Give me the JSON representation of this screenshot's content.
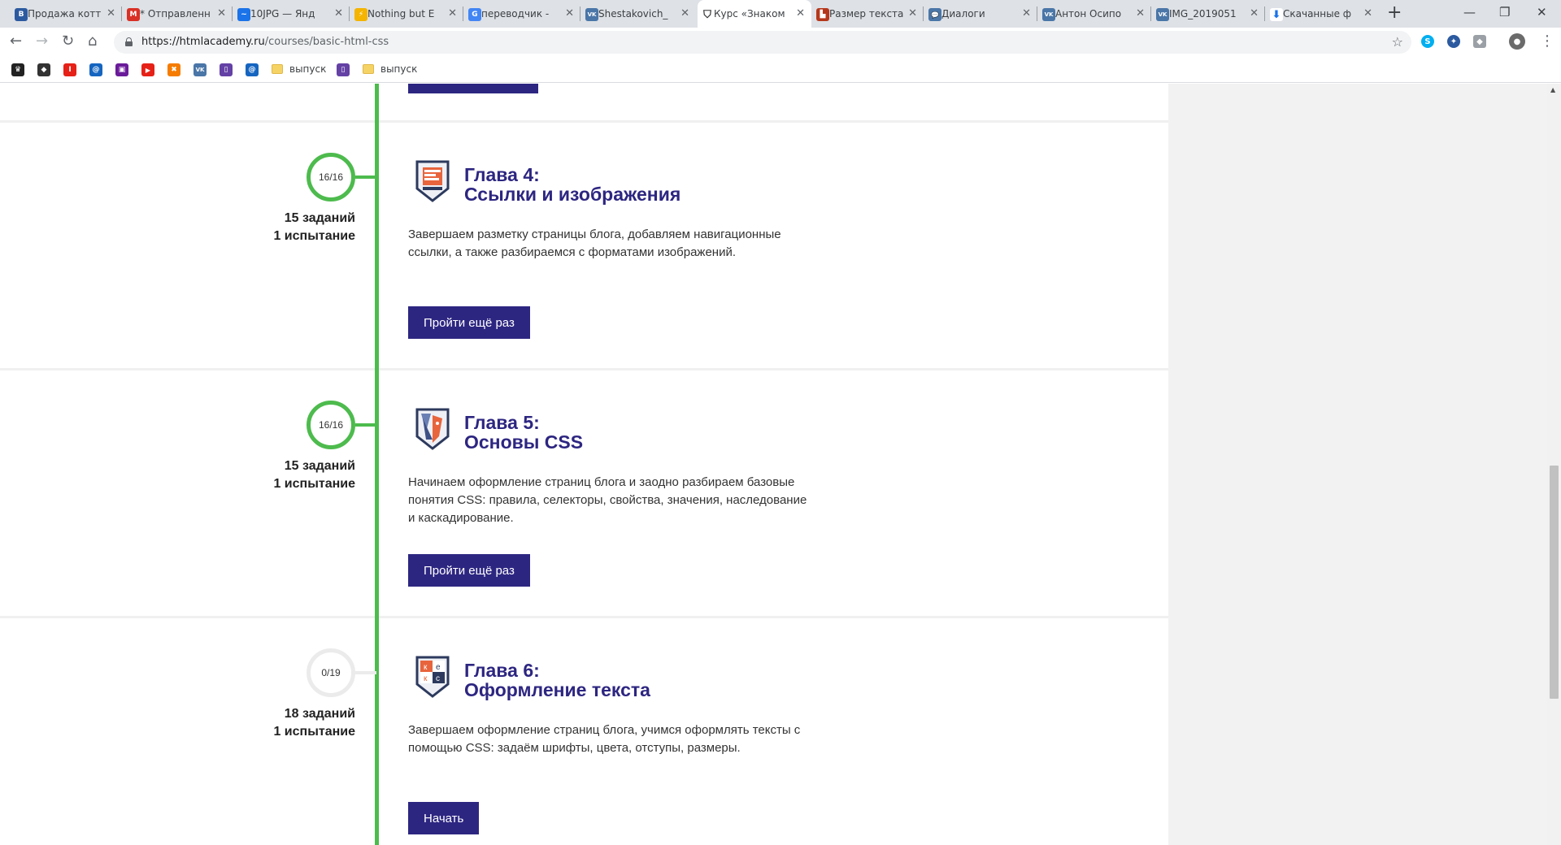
{
  "browser": {
    "tabs": [
      {
        "title": "Продажа котт",
        "favicon_color": "#2c5aa0",
        "favicon_char": "B"
      },
      {
        "title": "* Отправленн",
        "favicon_color": "#d93025",
        "favicon_char": "M"
      },
      {
        "title": "10JPG — Янд",
        "favicon_color": "#1a73e8",
        "favicon_char": "~"
      },
      {
        "title": "Nothing but E",
        "favicon_color": "#f4b400",
        "favicon_char": "⚡"
      },
      {
        "title": "переводчик -",
        "favicon_color": "#4285f4",
        "favicon_char": "G"
      },
      {
        "title": "Shestakovich_",
        "favicon_color": "#4a76a8",
        "favicon_char": "VK"
      },
      {
        "title": "Курс «Знаком",
        "favicon_color": "#ffffff",
        "favicon_char": "⛉",
        "active": true
      },
      {
        "title": "Размер текста",
        "favicon_color": "#b5371b",
        "favicon_char": "▙"
      },
      {
        "title": "Диалоги",
        "favicon_color": "#4a76a8",
        "favicon_char": "💬"
      },
      {
        "title": "Антон Осипо",
        "favicon_color": "#4a76a8",
        "favicon_char": "VK"
      },
      {
        "title": "IMG_2019051",
        "favicon_color": "#4a76a8",
        "favicon_char": "VK"
      },
      {
        "title": "Скачанные ф",
        "favicon_color": "#1a73e8",
        "favicon_char": "⬇"
      }
    ],
    "new_tab_glyph": "+",
    "window_buttons": {
      "minimize": "—",
      "restore": "❐",
      "close": "✕"
    },
    "nav": {
      "back": "←",
      "forward": "→",
      "reload": "↻",
      "home": "⌂"
    },
    "url_host": "https://htmlacademy.ru",
    "url_path": "/courses/basic-html-css",
    "bookmark_star": "☆",
    "menu_glyph": "⋮",
    "bookmarks": [
      {
        "icon": "bookmark-icon-1",
        "color": "#222222",
        "char": "♛"
      },
      {
        "icon": "bookmark-icon-2",
        "color": "#333333",
        "char": "◆"
      },
      {
        "icon": "bookmark-icon-3",
        "color": "#e62117",
        "char": "I"
      },
      {
        "icon": "bookmark-icon-4",
        "color": "#1565c0",
        "char": "@"
      },
      {
        "icon": "bookmark-icon-5",
        "color": "#6a1b9a",
        "char": "▣"
      },
      {
        "icon": "youtube-icon",
        "color": "#e62117",
        "char": "▶"
      },
      {
        "icon": "bookmark-icon-7",
        "color": "#f57c00",
        "char": "✖"
      },
      {
        "icon": "vk-icon",
        "color": "#4a76a8",
        "char": "VK"
      },
      {
        "icon": "twitch-icon",
        "color": "#6441a5",
        "char": "▯"
      },
      {
        "icon": "bookmark-icon-10",
        "color": "#1565c0",
        "char": "@"
      }
    ],
    "bookmark_folders": [
      "выпуск",
      "выпуск"
    ]
  },
  "chapters": [
    {
      "progress": "16/16",
      "complete": true,
      "tasks": "15 заданий",
      "trials": "1 испытание",
      "title_line1": "Глава 4:",
      "title_line2": "Ссылки и изображения",
      "description": "Завершаем разметку страницы блога, добавляем навигационные ссылки, а также разбираемся с форматами изображений.",
      "button": "Пройти ещё раз"
    },
    {
      "progress": "16/16",
      "complete": true,
      "tasks": "15 заданий",
      "trials": "1 испытание",
      "title_line1": "Глава 5:",
      "title_line2": "Основы CSS",
      "description": "Начинаем оформление страниц блога и заодно разбираем базовые понятия CSS: правила, селекторы, свойства, значения, наследование и каскадирование.",
      "button": "Пройти ещё раз"
    },
    {
      "progress": "0/19",
      "complete": false,
      "tasks": "18 заданий",
      "trials": "1 испытание",
      "title_line1": "Глава 6:",
      "title_line2": "Оформление текста",
      "description": "Завершаем оформление страниц блога, учимся оформлять тексты с помощью CSS: задаём шрифты, цвета, отступы, размеры.",
      "button": "Начать"
    }
  ],
  "colors": {
    "accent": "#2d2681",
    "timeline_green": "#4dbb4d",
    "timeline_inactive": "#ebebeb"
  }
}
